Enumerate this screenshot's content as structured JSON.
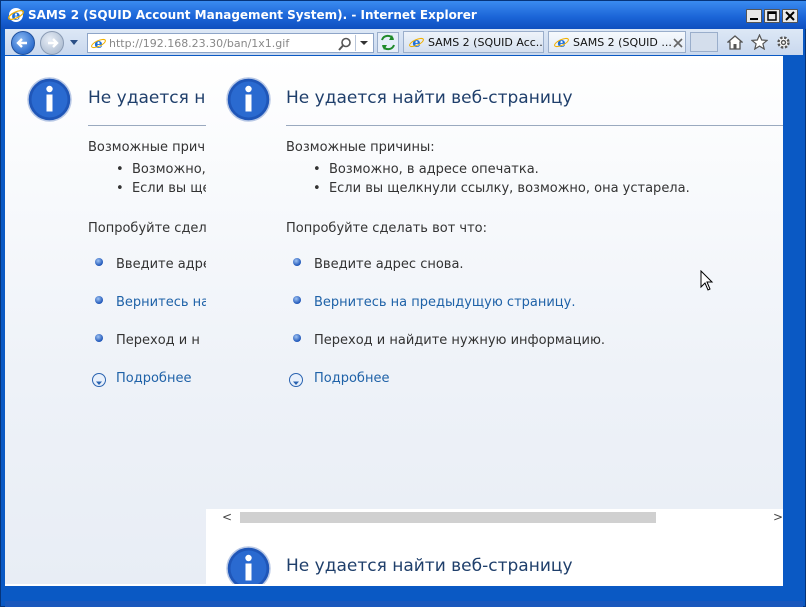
{
  "window": {
    "title": "SAMS 2 (SQUID Account Management System). - Internet Explorer"
  },
  "toolbar": {
    "address": "http://192.168.23.30/ban/1x1.gif",
    "tabs": [
      {
        "label": "SAMS 2 (SQUID Acc..."
      },
      {
        "label": "SAMS 2 (SQUID ..."
      }
    ]
  },
  "error_page": {
    "heading": "Не удается найти веб-страницу",
    "heading_truncated": "Не удается най",
    "causes_title": "Возможные причины:",
    "causes_title_truncated": "Возможные причи",
    "causes": [
      "Возможно, в адресе опечатка.",
      "Если вы щелкнули ссылку, возможно, она устарела."
    ],
    "causes_truncated": [
      "Возможно, ",
      "Если вы щел"
    ],
    "try_title": "Попробуйте сделать вот что:",
    "try_title_truncated": "Попробуйте сдела",
    "actions": [
      "Введите адрес снова.",
      "Вернитесь на предыдущую страницу.",
      "Переход   и найдите нужную информацию."
    ],
    "actions_truncated": [
      "Введите адрес",
      "Вернитесь на",
      "Переход   и н"
    ],
    "more": "Подробнее"
  },
  "scroll_arrows": {
    "left": "<",
    "right": ">",
    "up": "^",
    "down": "v"
  }
}
